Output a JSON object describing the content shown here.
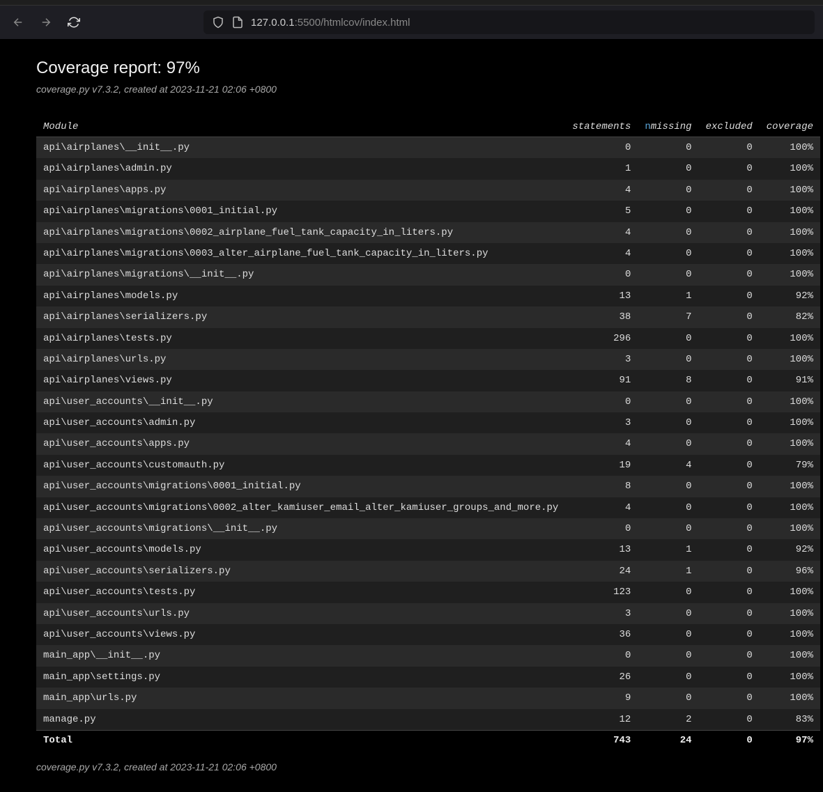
{
  "browser": {
    "url_host": "127.0.0.1",
    "url_rest": ":5500/htmlcov/index.html"
  },
  "header": {
    "title": "Coverage report: 97%",
    "subtitle": "coverage.py v7.3.2, created at 2023-11-21 02:06 +0800"
  },
  "table": {
    "columns": {
      "module": "Module",
      "statements": "statements",
      "missing": "missing",
      "excluded": "excluded",
      "coverage": "coverage"
    },
    "rows": [
      {
        "module": "api\\airplanes\\__init__.py",
        "statements": 0,
        "missing": 0,
        "excluded": 0,
        "coverage": "100%"
      },
      {
        "module": "api\\airplanes\\admin.py",
        "statements": 1,
        "missing": 0,
        "excluded": 0,
        "coverage": "100%"
      },
      {
        "module": "api\\airplanes\\apps.py",
        "statements": 4,
        "missing": 0,
        "excluded": 0,
        "coverage": "100%"
      },
      {
        "module": "api\\airplanes\\migrations\\0001_initial.py",
        "statements": 5,
        "missing": 0,
        "excluded": 0,
        "coverage": "100%"
      },
      {
        "module": "api\\airplanes\\migrations\\0002_airplane_fuel_tank_capacity_in_liters.py",
        "statements": 4,
        "missing": 0,
        "excluded": 0,
        "coverage": "100%"
      },
      {
        "module": "api\\airplanes\\migrations\\0003_alter_airplane_fuel_tank_capacity_in_liters.py",
        "statements": 4,
        "missing": 0,
        "excluded": 0,
        "coverage": "100%"
      },
      {
        "module": "api\\airplanes\\migrations\\__init__.py",
        "statements": 0,
        "missing": 0,
        "excluded": 0,
        "coverage": "100%"
      },
      {
        "module": "api\\airplanes\\models.py",
        "statements": 13,
        "missing": 1,
        "excluded": 0,
        "coverage": "92%"
      },
      {
        "module": "api\\airplanes\\serializers.py",
        "statements": 38,
        "missing": 7,
        "excluded": 0,
        "coverage": "82%"
      },
      {
        "module": "api\\airplanes\\tests.py",
        "statements": 296,
        "missing": 0,
        "excluded": 0,
        "coverage": "100%"
      },
      {
        "module": "api\\airplanes\\urls.py",
        "statements": 3,
        "missing": 0,
        "excluded": 0,
        "coverage": "100%"
      },
      {
        "module": "api\\airplanes\\views.py",
        "statements": 91,
        "missing": 8,
        "excluded": 0,
        "coverage": "91%"
      },
      {
        "module": "api\\user_accounts\\__init__.py",
        "statements": 0,
        "missing": 0,
        "excluded": 0,
        "coverage": "100%"
      },
      {
        "module": "api\\user_accounts\\admin.py",
        "statements": 3,
        "missing": 0,
        "excluded": 0,
        "coverage": "100%"
      },
      {
        "module": "api\\user_accounts\\apps.py",
        "statements": 4,
        "missing": 0,
        "excluded": 0,
        "coverage": "100%"
      },
      {
        "module": "api\\user_accounts\\customauth.py",
        "statements": 19,
        "missing": 4,
        "excluded": 0,
        "coverage": "79%"
      },
      {
        "module": "api\\user_accounts\\migrations\\0001_initial.py",
        "statements": 8,
        "missing": 0,
        "excluded": 0,
        "coverage": "100%"
      },
      {
        "module": "api\\user_accounts\\migrations\\0002_alter_kamiuser_email_alter_kamiuser_groups_and_more.py",
        "statements": 4,
        "missing": 0,
        "excluded": 0,
        "coverage": "100%"
      },
      {
        "module": "api\\user_accounts\\migrations\\__init__.py",
        "statements": 0,
        "missing": 0,
        "excluded": 0,
        "coverage": "100%"
      },
      {
        "module": "api\\user_accounts\\models.py",
        "statements": 13,
        "missing": 1,
        "excluded": 0,
        "coverage": "92%"
      },
      {
        "module": "api\\user_accounts\\serializers.py",
        "statements": 24,
        "missing": 1,
        "excluded": 0,
        "coverage": "96%"
      },
      {
        "module": "api\\user_accounts\\tests.py",
        "statements": 123,
        "missing": 0,
        "excluded": 0,
        "coverage": "100%"
      },
      {
        "module": "api\\user_accounts\\urls.py",
        "statements": 3,
        "missing": 0,
        "excluded": 0,
        "coverage": "100%"
      },
      {
        "module": "api\\user_accounts\\views.py",
        "statements": 36,
        "missing": 0,
        "excluded": 0,
        "coverage": "100%"
      },
      {
        "module": "main_app\\__init__.py",
        "statements": 0,
        "missing": 0,
        "excluded": 0,
        "coverage": "100%"
      },
      {
        "module": "main_app\\settings.py",
        "statements": 26,
        "missing": 0,
        "excluded": 0,
        "coverage": "100%"
      },
      {
        "module": "main_app\\urls.py",
        "statements": 9,
        "missing": 0,
        "excluded": 0,
        "coverage": "100%"
      },
      {
        "module": "manage.py",
        "statements": 12,
        "missing": 2,
        "excluded": 0,
        "coverage": "83%"
      }
    ],
    "total": {
      "label": "Total",
      "statements": 743,
      "missing": 24,
      "excluded": 0,
      "coverage": "97%"
    }
  },
  "footer": {
    "subtitle": "coverage.py v7.3.2, created at 2023-11-21 02:06 +0800"
  }
}
